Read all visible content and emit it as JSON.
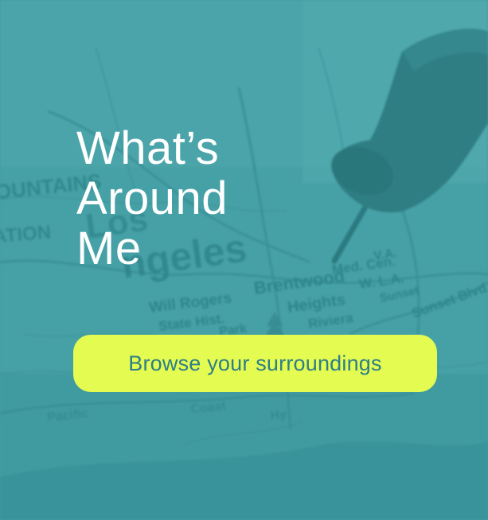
{
  "promo": {
    "title_lines": [
      "What’s",
      "Around",
      "Me"
    ],
    "cta_label": "Browse your surroundings"
  },
  "map": {
    "labels": {
      "mountains": "OUNTAINS",
      "nation": "ATION",
      "los": "Los",
      "angeles": "ngeles",
      "will_rogers": "Will Rogers",
      "state_hist": "State Hist.",
      "park": "Park",
      "brentwood": "Brentwood",
      "heights": "Heights",
      "riviera": "Riviera",
      "med_cen": "Med. Cen.",
      "va": "V.A.",
      "w_la": "W. L.A.",
      "sunset": "Sunset",
      "sunset_blvd": "Sunset Blvd",
      "pacific": "Pacific",
      "coast": "Coast",
      "hy": "Hy"
    }
  },
  "colors": {
    "overlay": "#3f9aa0",
    "button": "#e4fb52",
    "button_text": "#2e7f86",
    "title": "#ffffff"
  },
  "icons": [
    "push-pin-icon"
  ]
}
